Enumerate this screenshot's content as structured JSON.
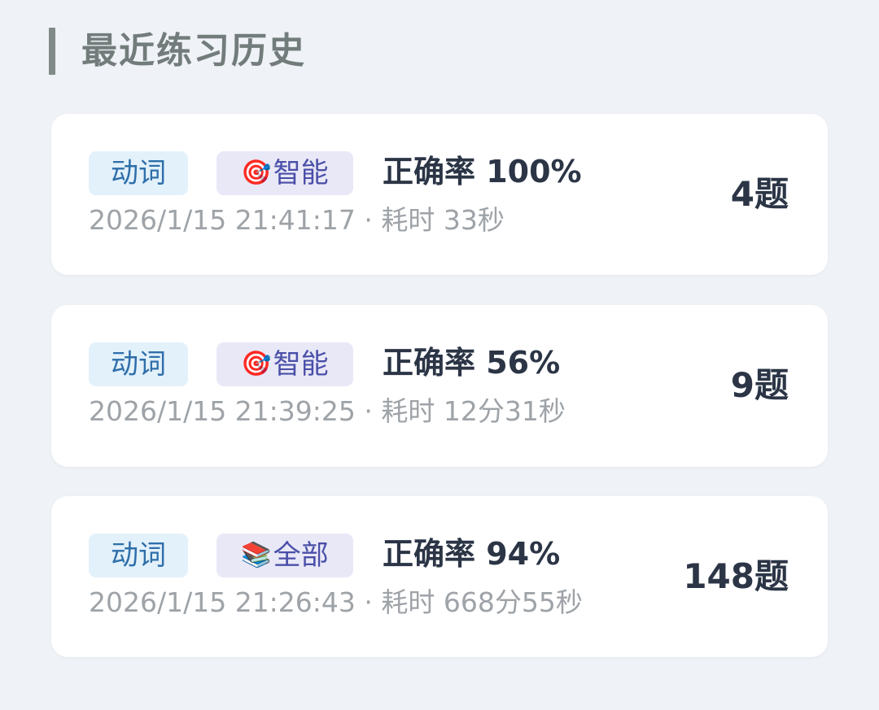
{
  "section": {
    "title": "最近练习历史"
  },
  "records": [
    {
      "category": "动词",
      "mode_icon": "🎯",
      "mode_icon_name": "target-icon",
      "mode_label": "智能",
      "accuracy": "正确率 100%",
      "meta": "2026/1/15 21:41:17 · 耗时 33秒",
      "count": "4题"
    },
    {
      "category": "动词",
      "mode_icon": "🎯",
      "mode_icon_name": "target-icon",
      "mode_label": "智能",
      "accuracy": "正确率 56%",
      "meta": "2026/1/15 21:39:25 · 耗时 12分31秒",
      "count": "9题"
    },
    {
      "category": "动词",
      "mode_icon": "📚",
      "mode_icon_name": "books-icon",
      "mode_label": "全部",
      "accuracy": "正确率 94%",
      "meta": "2026/1/15 21:26:43 · 耗时 668分55秒",
      "count": "148题"
    }
  ],
  "colors": {
    "background": "#eff2f6",
    "card": "#ffffff",
    "category_tag_bg": "#e3f1fb",
    "category_tag_text": "#2f6faa",
    "mode_tag_bg": "#e9e8f7",
    "mode_tag_text": "#4a4fa8",
    "primary_text": "#2b3546",
    "secondary_text": "#9ea3a8",
    "section_title": "#727c7b"
  }
}
